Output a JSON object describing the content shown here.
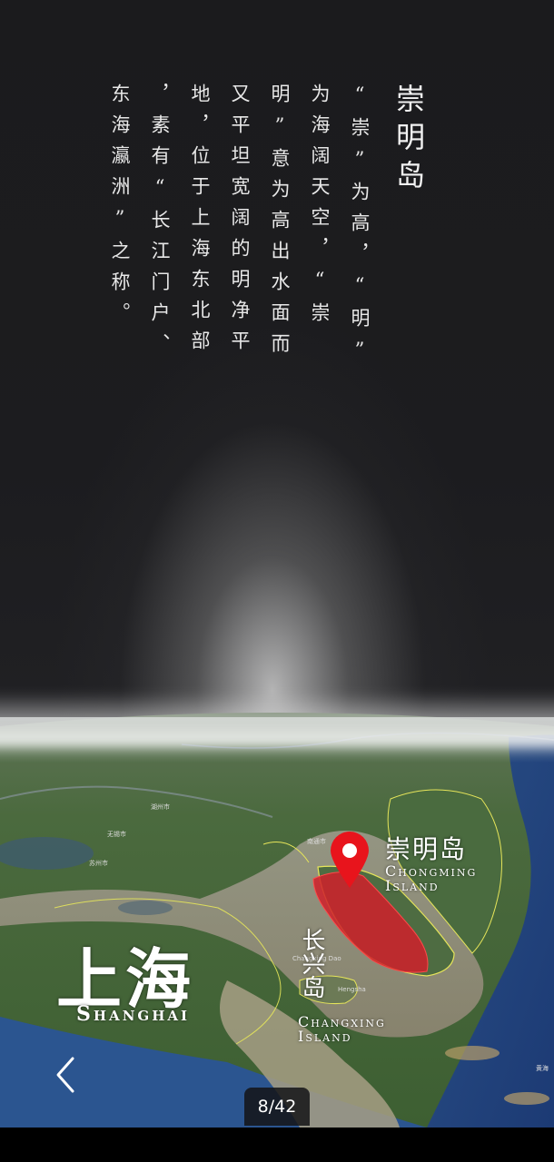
{
  "title": "崇明岛",
  "body_columns": [
    "“崇”为高，“明”",
    "为海阔天空，“崇",
    "明”意为高出水面而",
    "又平坦宽阔的明净平",
    "地，位于上海东北部",
    "，素有“长江门户、",
    "东海瀛洲”之称。"
  ],
  "map": {
    "shanghai_cn": "上海",
    "shanghai_en": "Shanghai",
    "chongming_cn": "崇明岛",
    "chongming_en": "Chongming Island",
    "changxing_cn": "长兴岛",
    "changxing_en": "Changxing Island",
    "small_labels": [
      "南通市",
      "苏州市",
      "无锡市",
      "Changxing Dao",
      "Hengsha",
      "黄海",
      "湖州市"
    ],
    "marker_icon": "map-pin-icon",
    "highlight_color": "#d0202a",
    "pin_color": "#e8141c"
  },
  "navigation": {
    "back_icon": "chevron-left-icon",
    "page_counter": "8/42"
  }
}
